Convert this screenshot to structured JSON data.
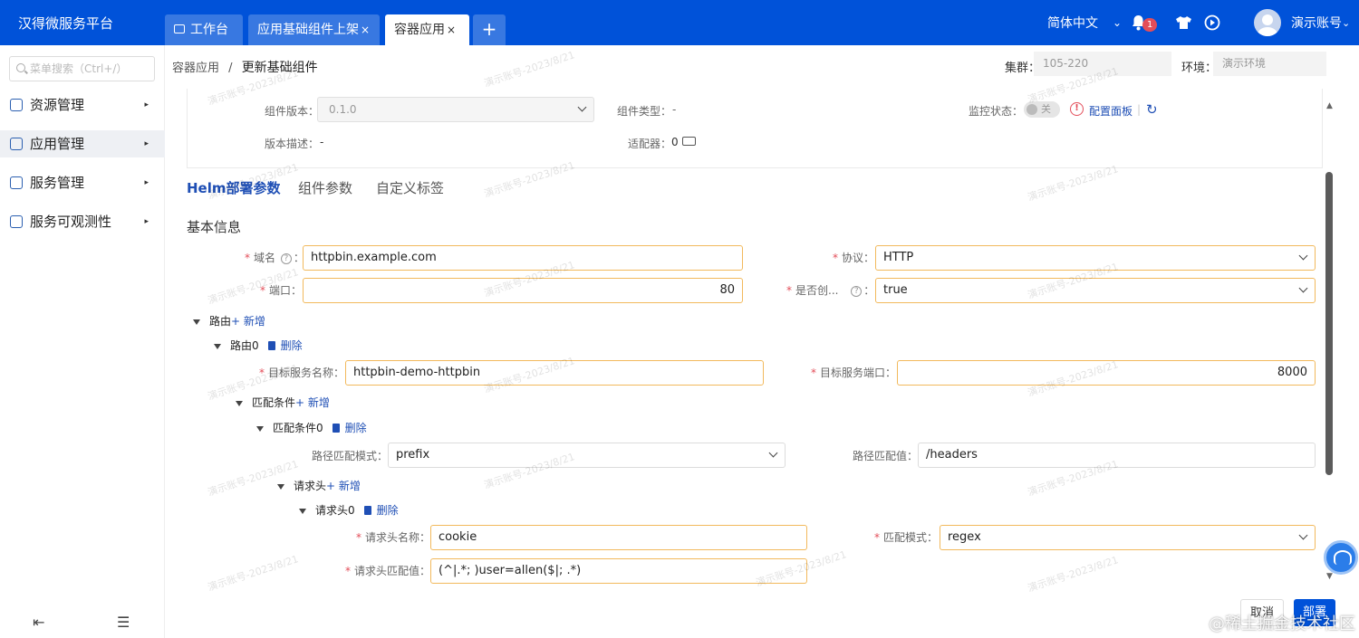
{
  "app": {
    "title": "汉得微服务平台"
  },
  "tabs": [
    {
      "label": "工作台"
    },
    {
      "label": "应用基础组件上架"
    },
    {
      "label": "容器应用"
    }
  ],
  "tab_close": "×",
  "tab_add": "+",
  "topbar": {
    "language": "简体中文",
    "lang_chevron": "⌄",
    "notification_count": "1",
    "user": "演示账号",
    "user_chevron": "⌄"
  },
  "sidebar": {
    "search_placeholder": "菜单搜索（Ctrl+/）",
    "items": [
      {
        "label": "资源管理",
        "arrow": "▸"
      },
      {
        "label": "应用管理",
        "arrow": "▸"
      },
      {
        "label": "服务管理",
        "arrow": "▸"
      },
      {
        "label": "服务可观测性",
        "arrow": "▸"
      }
    ],
    "collapse_icon": "⇤",
    "doc_icon": "☰"
  },
  "breadcrumb": {
    "parent": "容器应用",
    "sep": "/",
    "current": "更新基础组件"
  },
  "header_fields": {
    "cluster_label": "集群：",
    "cluster_value": "105-220",
    "env_label": "环境：",
    "env_value": "演示环境"
  },
  "component": {
    "version_label": "组件版本：",
    "version_value": "0.1.0",
    "type_label": "组件类型：",
    "type_value": "-",
    "monitor_label": "监控状态：",
    "monitor_toggle": "关",
    "config_panel": "配置面板",
    "refresh": "↻",
    "divider": "|",
    "warn_icon": "!",
    "desc_label": "版本描述：",
    "desc_value": "-",
    "adapter_label": "适配器：",
    "adapter_value": "0"
  },
  "form_tabs": [
    {
      "label": "Helm部署参数"
    },
    {
      "label": "组件参数"
    },
    {
      "label": "自定义标签"
    }
  ],
  "section_title": "基本信息",
  "required_mark": "*",
  "help_mark": "?",
  "fields": {
    "domain_label": "域名",
    "domain_value": "httpbin.example.com",
    "protocol_label": "协议：",
    "protocol_value": "HTTP",
    "port_label": "端口：",
    "port_value": "80",
    "create_label": "是否创...",
    "create_value": "true",
    "colon": "："
  },
  "routes": {
    "label": "路由",
    "add_label": "+ 新增",
    "route0": "路由0",
    "delete_label": "删除",
    "target_service_label": "目标服务名称：",
    "target_service_value": "httpbin-demo-httpbin",
    "target_port_label": "目标服务端口：",
    "target_port_value": "8000",
    "match_label": "匹配条件",
    "match0": "匹配条件0",
    "path_mode_label": "路径匹配模式：",
    "path_mode_value": "prefix",
    "path_value_label": "路径匹配值：",
    "path_value": "/headers",
    "headers_label": "请求头",
    "header0": "请求头0",
    "header_name_label": "请求头名称：",
    "header_name_value": "cookie",
    "match_mode_label": "匹配模式：",
    "match_mode_value": "regex",
    "header_value_label": "请求头匹配值：",
    "header_value_value": "(^|.*; )user=allen($|; .*)"
  },
  "buttons": {
    "cancel": "取消",
    "deploy": "部署"
  },
  "scroll_up": "▲",
  "scroll_down": "▼",
  "watermark": "演示账号-2023/8/21",
  "footer_watermark": "@稀土掘金技术社区",
  "colors": {
    "primary": "#0052d9",
    "required": "#e34d59",
    "focus_border": "#f2b95c"
  }
}
